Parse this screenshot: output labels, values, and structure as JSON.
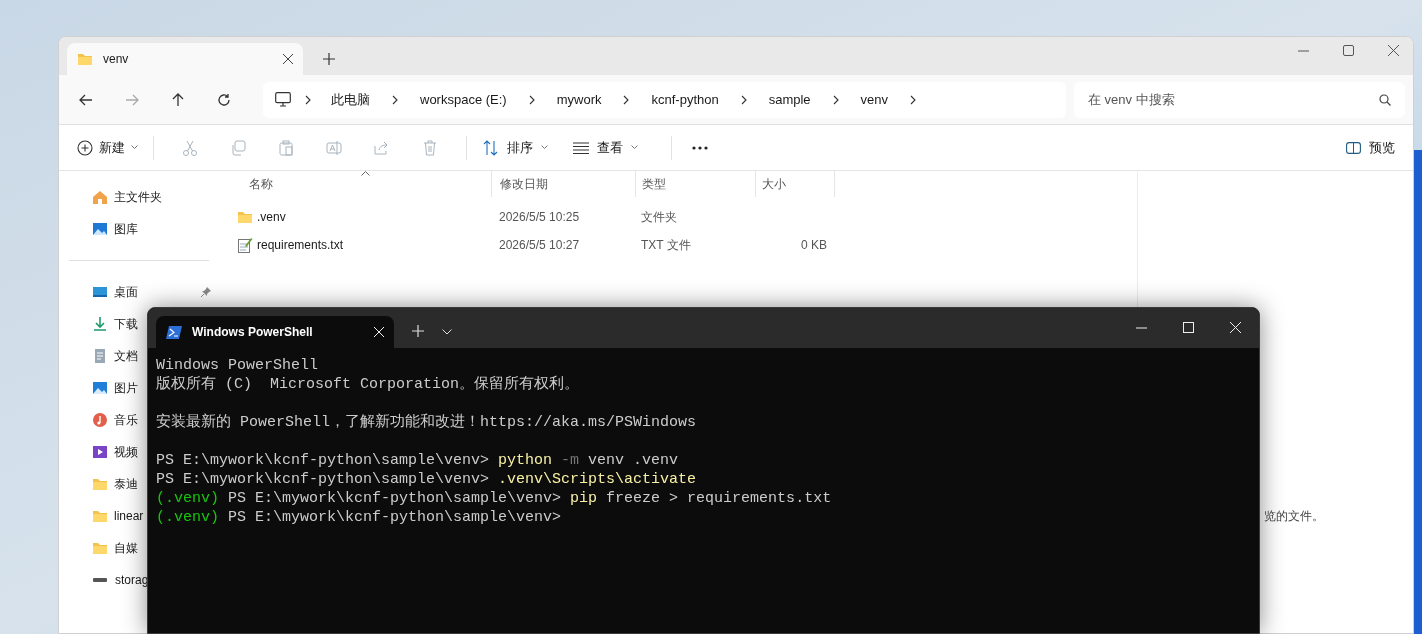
{
  "explorer": {
    "tabs": [
      {
        "label": "venv",
        "selected": true
      }
    ],
    "breadcrumb": [
      "此电脑",
      "workspace (E:)",
      "mywork",
      "kcnf-python",
      "sample",
      "venv"
    ],
    "search": {
      "placeholder": "在 venv 中搜索"
    },
    "toolbar": {
      "new": "新建",
      "edit_actions_disabled": true,
      "sort": "排序",
      "view": "查看",
      "preview": "预览"
    },
    "sidebar": {
      "groups": [
        {
          "items": [
            {
              "label": "主文件夹",
              "kind": "home"
            },
            {
              "label": "图库",
              "kind": "gallery"
            }
          ]
        },
        {
          "items": [
            {
              "label": "桌面",
              "kind": "desktop",
              "pinned": true
            },
            {
              "label": "下载",
              "kind": "download"
            },
            {
              "label": "文档",
              "kind": "document"
            },
            {
              "label": "图片",
              "kind": "pictures"
            },
            {
              "label": "音乐",
              "kind": "music"
            },
            {
              "label": "视频",
              "kind": "video"
            },
            {
              "label": "泰迪",
              "kind": "folder"
            },
            {
              "label": "linear",
              "kind": "folder"
            },
            {
              "label": "自媒",
              "kind": "folder"
            },
            {
              "label": "storag",
              "kind": "drive"
            }
          ]
        }
      ]
    },
    "columns": [
      "名称",
      "修改日期",
      "类型",
      "大小"
    ],
    "rows": [
      {
        "name": ".venv",
        "date": "2026/5/5 10:25",
        "type": "文件夹",
        "kind": "folder"
      },
      {
        "name": "requirements.txt",
        "date": "2026/5/5 10:27",
        "type": "TXT 文件",
        "size": "0 KB",
        "kind": "text"
      }
    ],
    "preview_pane": {
      "message": "览的文件。"
    }
  },
  "terminal": {
    "tabs": [
      {
        "title": "Windows PowerShell",
        "selected": true
      }
    ],
    "lines": [
      {
        "segments": [
          {
            "text": "Windows PowerShell",
            "kind": "plain"
          }
        ]
      },
      {
        "segments": [
          {
            "text": "版权所有 (C)  Microsoft Corporation。保留所有权利。",
            "kind": "plain"
          }
        ]
      },
      {
        "kind": "blank"
      },
      {
        "segments": [
          {
            "text": "安装最新的 PowerShell，了解新功能和改进！https://aka.ms/PSWindows",
            "kind": "plain"
          }
        ]
      },
      {
        "kind": "blank"
      },
      {
        "segments": [
          {
            "text": "PS E:\\mywork\\kcnf-python\\sample\\venv> ",
            "kind": "plain"
          },
          {
            "text": "python",
            "kind": "command"
          },
          {
            "text": " -m",
            "kind": "flag"
          },
          {
            "text": " venv .venv",
            "kind": "plain"
          }
        ]
      },
      {
        "segments": [
          {
            "text": "PS E:\\mywork\\kcnf-python\\sample\\venv> ",
            "kind": "plain"
          },
          {
            "text": ".venv\\Scripts\\activate",
            "kind": "command"
          }
        ]
      },
      {
        "segments": [
          {
            "text": "(.venv)",
            "kind": "venv"
          },
          {
            "text": " PS E:\\mywork\\kcnf-python\\sample\\venv> ",
            "kind": "plain"
          },
          {
            "text": "pip",
            "kind": "command"
          },
          {
            "text": " freeze > requirements.txt",
            "kind": "plain"
          }
        ]
      },
      {
        "segments": [
          {
            "text": "(.venv)",
            "kind": "venv"
          },
          {
            "text": " PS E:\\mywork\\kcnf-python\\sample\\venv>",
            "kind": "plain"
          }
        ]
      }
    ]
  }
}
